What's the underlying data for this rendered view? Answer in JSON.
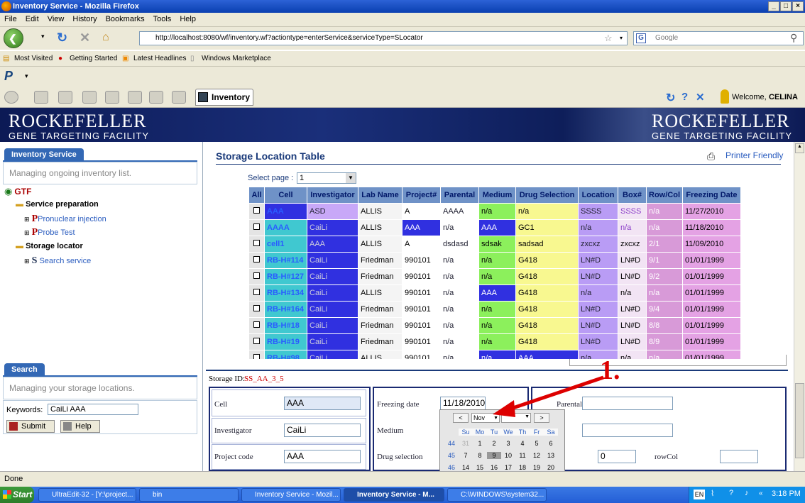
{
  "window": {
    "title": "Inventory Service - Mozilla Firefox"
  },
  "menu": [
    "File",
    "Edit",
    "View",
    "History",
    "Bookmarks",
    "Tools",
    "Help"
  ],
  "nav": {
    "url": "http://localhost:8080/wf/inventory.wf?actiontype=enterService&serviceType=SLocator",
    "search_placeholder": "Google"
  },
  "bookmarks": [
    "Most Visited",
    "Getting Started",
    "Latest Headlines",
    "Windows Marketplace"
  ],
  "toolbar": {
    "tab_label": "Inventory",
    "welcome": "Welcome,",
    "user": "CELINA"
  },
  "banner": {
    "logo_line1": "ROCKEFELLER",
    "logo_line2": "GENE TARGETING FACILITY"
  },
  "left": {
    "inventory_tab": "Inventory Service",
    "inventory_desc": "Managing ongoing inventory list.",
    "tree_root": "GTF",
    "tree_service_prep": "Service preparation",
    "tree_pronuclear": "Pronuclear injection",
    "tree_probe": "Probe Test",
    "tree_storage": "Storage locator",
    "tree_search_service": "Search service",
    "search_tab": "Search",
    "search_desc": "Managing your storage locations.",
    "keywords_label": "Keywords:",
    "keywords_value": "CaiLi  AAA",
    "submit": "Submit",
    "help": "Help"
  },
  "main": {
    "title": "Storage Location Table",
    "printer": "Printer Friendly",
    "select_page_label": "Select page :",
    "select_page_value": "1",
    "columns": [
      "All",
      "Cell",
      "Investigator",
      "Lab Name",
      "Project#",
      "Parental",
      "Medium",
      "Drug Selection",
      "Location",
      "Box#",
      "Row/Col",
      "Freezing Date"
    ],
    "rows": [
      [
        "AAA",
        "ASD",
        "ALLIS",
        "A",
        "AAAA",
        "n/a",
        "n/a",
        "SSSS",
        "SSSS",
        "n/a",
        "11/27/2010"
      ],
      [
        "AAAA",
        "CaiLi",
        "ALLIS",
        "AAA",
        "n/a",
        "AAA",
        "GC1",
        "n/a",
        "n/a",
        "n/a",
        "11/18/2010"
      ],
      [
        "cell1",
        "AAA",
        "ALLIS",
        "A",
        "dsdasd",
        "sdsak",
        "sadsad",
        "zxcxz",
        "zxcxz",
        "2/1",
        "11/09/2010"
      ],
      [
        "RB-H#114",
        "CaiLi",
        "Friedman",
        "990101",
        "n/a",
        "n/a",
        "G418",
        "LN#D",
        "LN#D",
        "9/1",
        "01/01/1999"
      ],
      [
        "RB-H#127",
        "CaiLi",
        "Friedman",
        "990101",
        "n/a",
        "n/a",
        "G418",
        "LN#D",
        "LN#D",
        "9/2",
        "01/01/1999"
      ],
      [
        "RB-H#134",
        "CaiLi",
        "ALLIS",
        "990101",
        "n/a",
        "AAA",
        "G418",
        "n/a",
        "n/a",
        "n/a",
        "01/01/1999"
      ],
      [
        "RB-H#164",
        "CaiLi",
        "Friedman",
        "990101",
        "n/a",
        "n/a",
        "G418",
        "LN#D",
        "LN#D",
        "9/4",
        "01/01/1999"
      ],
      [
        "RB-H#18",
        "CaiLi",
        "Friedman",
        "990101",
        "n/a",
        "n/a",
        "G418",
        "LN#D",
        "LN#D",
        "8/8",
        "01/01/1999"
      ],
      [
        "RB-H#19",
        "CaiLi",
        "Friedman",
        "990101",
        "n/a",
        "n/a",
        "G418",
        "LN#D",
        "LN#D",
        "8/9",
        "01/01/1999"
      ],
      [
        "RB-H#98",
        "CaiLi",
        "ALLIS",
        "990101",
        "n/a",
        "n/a",
        "AAA",
        "n/a",
        "n/a",
        "n/a",
        "01/01/1999"
      ]
    ],
    "storage_id_label": "Storage ID:",
    "storage_id_value": "SS_AA_3_5",
    "annotation": "1."
  },
  "form": {
    "cell_label": "Cell",
    "cell_value": "AAA",
    "investigator_label": "Investigator",
    "investigator_value": "CaiLi",
    "project_label": "Project code",
    "project_value": "AAA",
    "freezing_label": "Freezing date",
    "freezing_value": "11/18/2010",
    "medium_label": "Medium",
    "drug_label": "Drug selection",
    "parental_label": "Parental line",
    "qty_value": "0",
    "rowcol_label": "rowCol"
  },
  "calendar": {
    "month": "Nov",
    "prev": "<",
    "next": ">",
    "days": [
      "Su",
      "Mo",
      "Tu",
      "We",
      "Th",
      "Fr",
      "Sa"
    ],
    "weeks": [
      {
        "wk": "44",
        "d": [
          "31",
          "1",
          "2",
          "3",
          "4",
          "5",
          "6"
        ]
      },
      {
        "wk": "45",
        "d": [
          "7",
          "8",
          "9",
          "10",
          "11",
          "12",
          "13"
        ]
      },
      {
        "wk": "46",
        "d": [
          "14",
          "15",
          "16",
          "17",
          "18",
          "19",
          "20"
        ]
      }
    ]
  },
  "status": "Done",
  "taskbar": {
    "start": "Start",
    "tasks": [
      "UltraEdit-32 - [Y:\\project...",
      "bin",
      "Inventory Service - Mozil...",
      "Inventory Service - M...",
      "C:\\WINDOWS\\system32..."
    ],
    "lang": "EN",
    "clock": "3:18 PM"
  }
}
